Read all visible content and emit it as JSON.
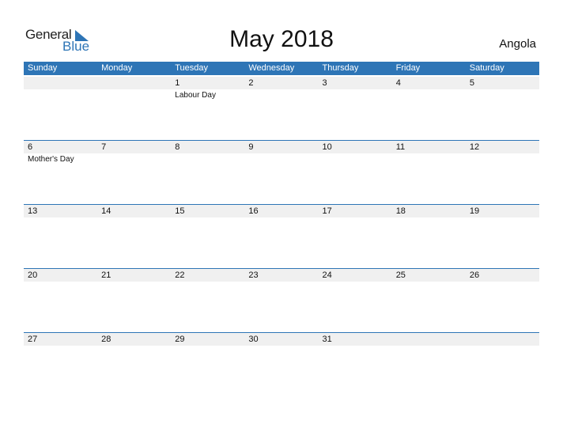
{
  "logo": {
    "general": "General",
    "blue": "Blue"
  },
  "title": "May 2018",
  "country": "Angola",
  "colors": {
    "accent": "#2e75b6",
    "date_strip": "#f0f0f0"
  },
  "weekdays": [
    "Sunday",
    "Monday",
    "Tuesday",
    "Wednesday",
    "Thursday",
    "Friday",
    "Saturday"
  ],
  "weeks": [
    [
      {
        "day": "",
        "event": ""
      },
      {
        "day": "",
        "event": ""
      },
      {
        "day": "1",
        "event": "Labour Day"
      },
      {
        "day": "2",
        "event": ""
      },
      {
        "day": "3",
        "event": ""
      },
      {
        "day": "4",
        "event": ""
      },
      {
        "day": "5",
        "event": ""
      }
    ],
    [
      {
        "day": "6",
        "event": "Mother's Day"
      },
      {
        "day": "7",
        "event": ""
      },
      {
        "day": "8",
        "event": ""
      },
      {
        "day": "9",
        "event": ""
      },
      {
        "day": "10",
        "event": ""
      },
      {
        "day": "11",
        "event": ""
      },
      {
        "day": "12",
        "event": ""
      }
    ],
    [
      {
        "day": "13",
        "event": ""
      },
      {
        "day": "14",
        "event": ""
      },
      {
        "day": "15",
        "event": ""
      },
      {
        "day": "16",
        "event": ""
      },
      {
        "day": "17",
        "event": ""
      },
      {
        "day": "18",
        "event": ""
      },
      {
        "day": "19",
        "event": ""
      }
    ],
    [
      {
        "day": "20",
        "event": ""
      },
      {
        "day": "21",
        "event": ""
      },
      {
        "day": "22",
        "event": ""
      },
      {
        "day": "23",
        "event": ""
      },
      {
        "day": "24",
        "event": ""
      },
      {
        "day": "25",
        "event": ""
      },
      {
        "day": "26",
        "event": ""
      }
    ],
    [
      {
        "day": "27",
        "event": ""
      },
      {
        "day": "28",
        "event": ""
      },
      {
        "day": "29",
        "event": ""
      },
      {
        "day": "30",
        "event": ""
      },
      {
        "day": "31",
        "event": ""
      },
      {
        "day": "",
        "event": ""
      },
      {
        "day": "",
        "event": ""
      }
    ]
  ]
}
